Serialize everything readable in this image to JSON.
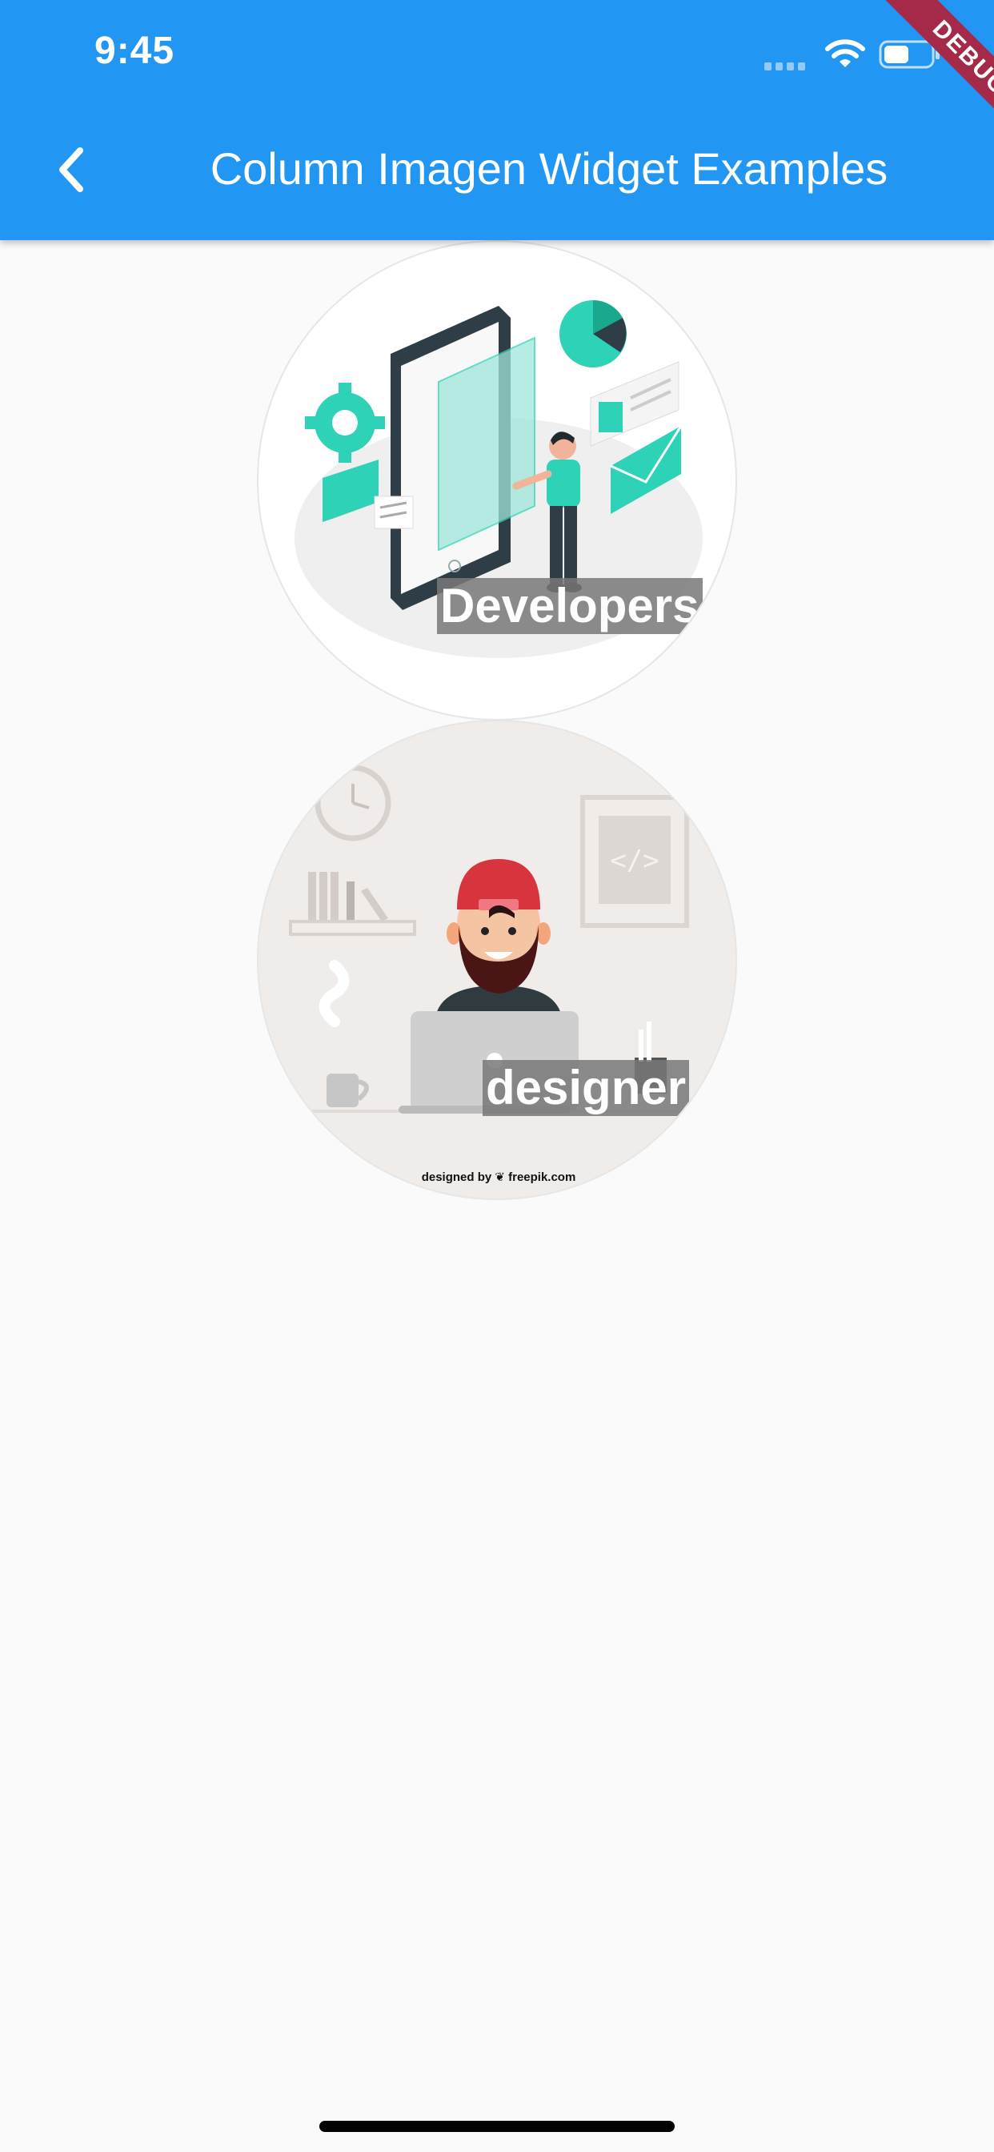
{
  "status_bar": {
    "time": "9:45"
  },
  "app_bar": {
    "title": "Column Imagen Widget Examples",
    "back_icon": "chevron-left-icon"
  },
  "debug_banner": {
    "label": "DEBUG"
  },
  "cards": [
    {
      "caption": "Developers"
    },
    {
      "caption": "designer",
      "credit": "designed by ❦ freepik.com"
    }
  ],
  "colors": {
    "app_bar": "#2196f3",
    "background": "#fafafa",
    "accent": "#2ed3b7",
    "debug": "#a52a4a"
  }
}
